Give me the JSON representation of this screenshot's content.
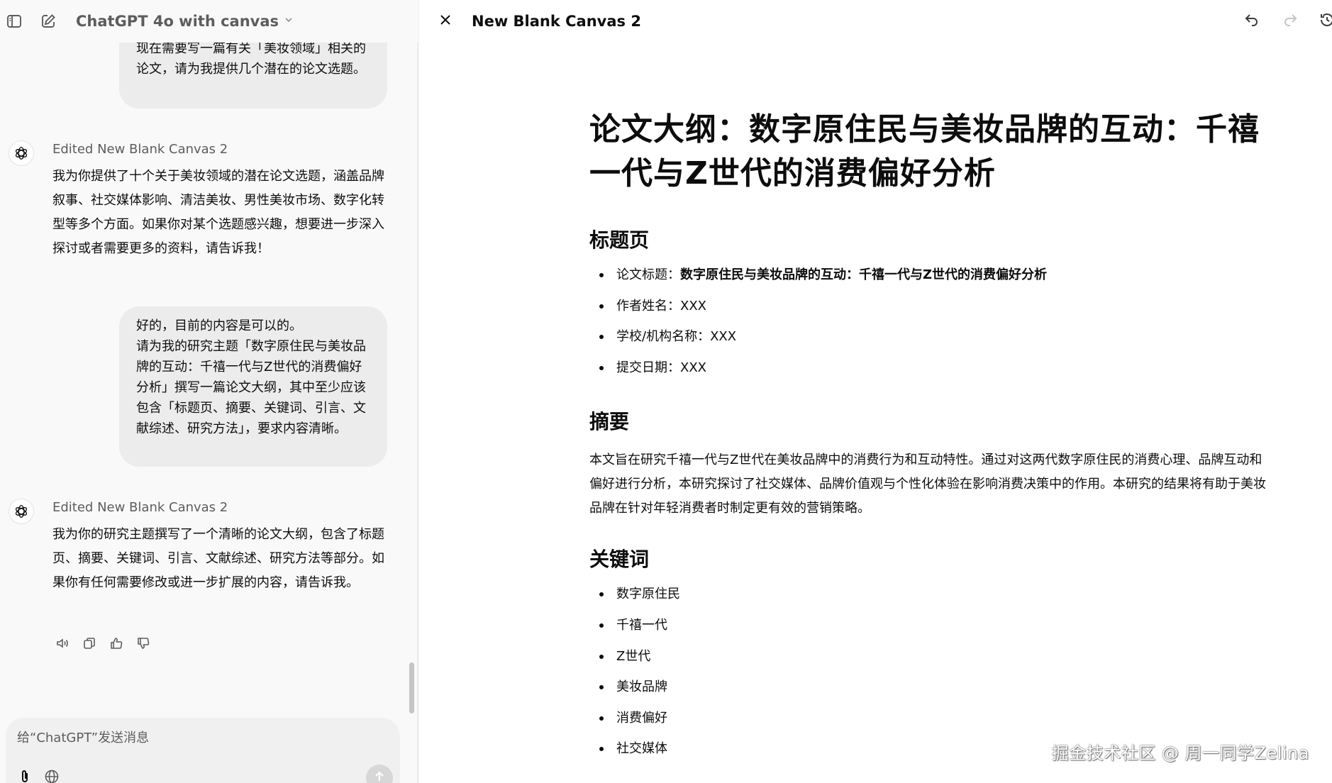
{
  "header": {
    "model_title": "ChatGPT 4o with canvas",
    "sidebar_toggle_icon": "sidebar-toggle-icon",
    "new_chat_icon": "new-chat-icon"
  },
  "chat": {
    "user_messages": [
      "现在需要写一篇有关「美妆领域」相关的论文，请为我提供几个潜在的论文选题。",
      "好的，目前的内容是可以的。\n请为我的研究主题「数字原住民与美妆品牌的互动：千禧一代与Z世代的消费偏好分析」撰写一篇论文大纲，其中至少应该包含「标题页、摘要、关键词、引言、文献综述、研究方法」，要求内容清晰。"
    ],
    "bot_messages": [
      {
        "edited": "Edited New Blank Canvas 2",
        "text": "我为你提供了十个关于美妆领域的潜在论文选题，涵盖品牌叙事、社交媒体影响、清洁美妆、男性美妆市场、数字化转型等多个方面。如果你对某个选题感兴趣，想要进一步深入探讨或者需要更多的资料，请告诉我！"
      },
      {
        "edited": "Edited New Blank Canvas 2",
        "text": "我为你的研究主题撰写了一个清晰的论文大纲，包含了标题页、摘要、关键词、引言、文献综述、研究方法等部分。如果你有任何需要修改或进一步扩展的内容，请告诉我。"
      }
    ],
    "composer_placeholder": "给“ChatGPT”发送消息"
  },
  "canvas": {
    "title": "New Blank Canvas 2",
    "doc_title": "论文大纲：数字原住民与美妆品牌的互动：千禧一代与Z世代的消费偏好分析",
    "sections": {
      "title_page": {
        "heading": "标题页",
        "items": {
          "thesis_label": "论文标题：",
          "thesis_value": "数字原住民与美妆品牌的互动：千禧一代与Z世代的消费偏好分析",
          "author": "作者姓名：XXX",
          "school": "学校/机构名称：XXX",
          "date": "提交日期：XXX"
        }
      },
      "abstract": {
        "heading": "摘要",
        "text": "本文旨在研究千禧一代与Z世代在美妆品牌中的消费行为和互动特性。通过对这两代数字原住民的消费心理、品牌互动和偏好进行分析，本研究探讨了社交媒体、品牌价值观与个性化体验在影响消费决策中的作用。本研究的结果将有助于美妆品牌在针对年轻消费者时制定更有效的营销策略。"
      },
      "keywords": {
        "heading": "关键词",
        "items": [
          "数字原住民",
          "千禧一代",
          "Z世代",
          "美妆品牌",
          "消费偏好",
          "社交媒体"
        ]
      }
    }
  },
  "watermark": "掘金技术社区 @ 周一同学Zelina"
}
